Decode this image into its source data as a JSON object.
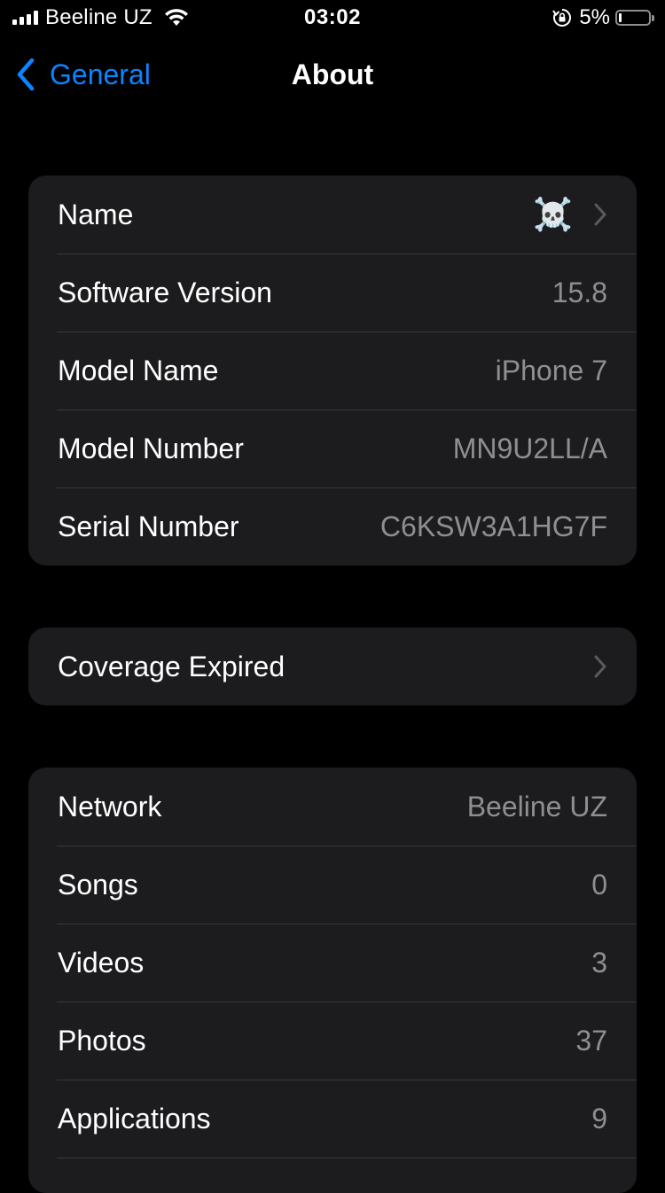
{
  "status_bar": {
    "carrier": "Beeline UZ",
    "time": "03:02",
    "battery_percent": "5%",
    "battery_level": 0.05,
    "icons": [
      "signal-icon",
      "wifi-icon",
      "rotation-lock-icon",
      "battery-icon"
    ]
  },
  "nav": {
    "back_label": "General",
    "title": "About"
  },
  "group1": {
    "rows": [
      {
        "label": "Name",
        "value": "☠️"
      },
      {
        "label": "Software Version",
        "value": "15.8"
      },
      {
        "label": "Model Name",
        "value": "iPhone 7"
      },
      {
        "label": "Model Number",
        "value": "MN9U2LL/A"
      },
      {
        "label": "Serial Number",
        "value": "C6KSW3A1HG7F"
      }
    ]
  },
  "group2": {
    "rows": [
      {
        "label": "Coverage Expired"
      }
    ]
  },
  "group3": {
    "rows": [
      {
        "label": "Network",
        "value": "Beeline UZ"
      },
      {
        "label": "Songs",
        "value": "0"
      },
      {
        "label": "Videos",
        "value": "3"
      },
      {
        "label": "Photos",
        "value": "37"
      },
      {
        "label": "Applications",
        "value": "9"
      }
    ]
  },
  "colors": {
    "background": "#000000",
    "cell_background": "#1c1c1e",
    "separator": "#38383a",
    "accent": "#0a84ff",
    "secondary_text": "#8e8e93"
  }
}
